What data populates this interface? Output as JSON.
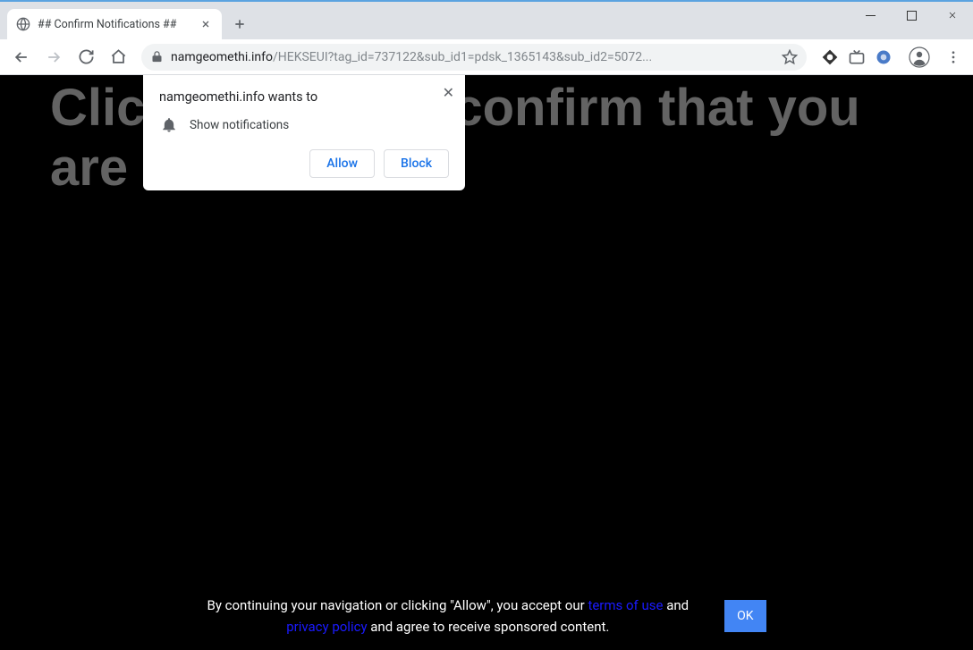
{
  "tab": {
    "title": "## Confirm Notifications ##"
  },
  "url": {
    "domain": "namgeomethi.info",
    "path": "/HEKSEUI?tag_id=737122&sub_id1=pdsk_1365143&sub_id2=5072..."
  },
  "permission": {
    "title": "namgeomethi.info wants to",
    "item": "Show notifications",
    "allow": "Allow",
    "block": "Block"
  },
  "page": {
    "headline_full": "Click \"Allow\" to confirm that you are not a robot!",
    "cookie_pre": "By continuing your navigation or clicking \"Allow\", you accept our ",
    "terms": "terms of use",
    "and": " and ",
    "privacy": "privacy policy",
    "cookie_post": " and agree to receive sponsored content.",
    "ok": "OK"
  }
}
